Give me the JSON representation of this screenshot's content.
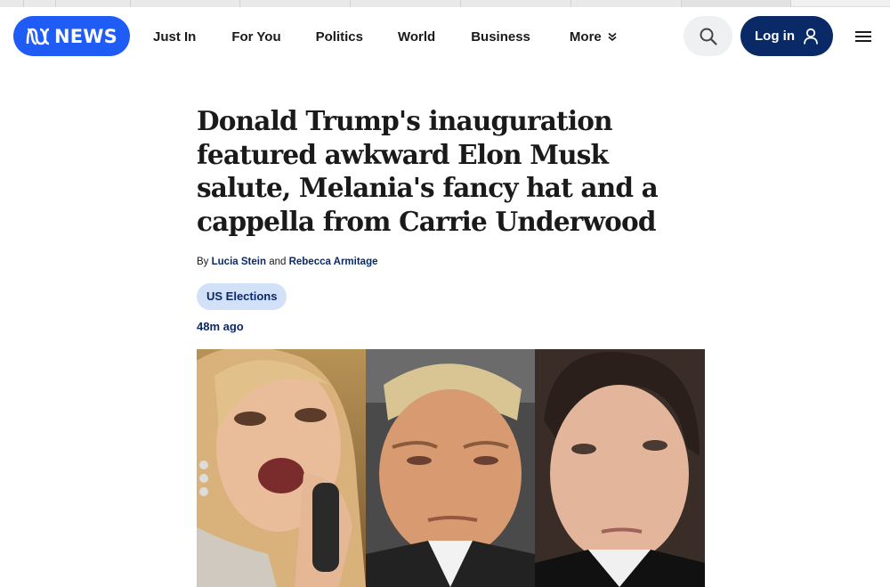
{
  "header": {
    "logo_text": "NEWS",
    "nav": [
      {
        "label": "Just In"
      },
      {
        "label": "For You"
      },
      {
        "label": "Politics"
      },
      {
        "label": "World"
      },
      {
        "label": "Business"
      },
      {
        "label": "More"
      }
    ],
    "login_label": "Log in",
    "colors": {
      "brand_blue": "#1f5cf5",
      "navy": "#0a2a67",
      "tag_bg": "#d2e1f7"
    },
    "icons": [
      "abc-logo-icon",
      "chevron-down-icon",
      "search-icon",
      "user-icon",
      "hamburger-menu-icon"
    ]
  },
  "article": {
    "headline": "Donald Trump's inauguration featured awkward Elon Musk salute, Melania's fancy hat and a cappella from Carrie Underwood",
    "byline_prefix": "By",
    "authors": [
      "Lucia Stein",
      "Rebecca Armitage"
    ],
    "byline_joiner": "and",
    "tag": "US Elections",
    "timestamp": "48m ago"
  }
}
